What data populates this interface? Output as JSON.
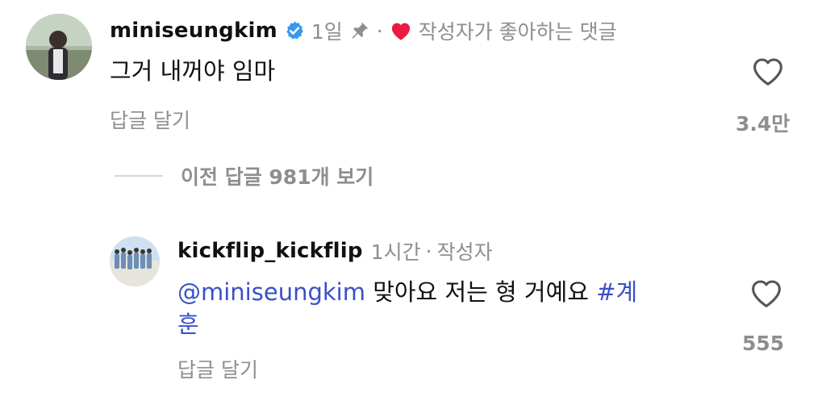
{
  "comment": {
    "username": "miniseungkim",
    "verified_icon": "verified-badge-icon",
    "time": "1일",
    "pinned_icon": "pin-icon",
    "separator": "·",
    "liked_by_author_label": "작성자가 좋아하는 댓글",
    "text": "그거 내꺼야 임마",
    "reply_label": "답글 달기",
    "like_count": "3.4만"
  },
  "view_previous": {
    "label": "이전 답글 981개 보기"
  },
  "reply": {
    "username": "kickflip_kickflip",
    "time": "1시간",
    "separator": "·",
    "author_label": "작성자",
    "mention": "@miniseungkim",
    "text_body": "맞아요 저는 형 거예요",
    "hashtag_line1": "#계",
    "hashtag_line2": "훈",
    "reply_label": "답글 달기",
    "like_count": "555"
  },
  "colors": {
    "verified": "#3897f0",
    "heart_red": "#ed1943",
    "link_blue": "#3a50c9",
    "muted": "#8e8e8e"
  }
}
